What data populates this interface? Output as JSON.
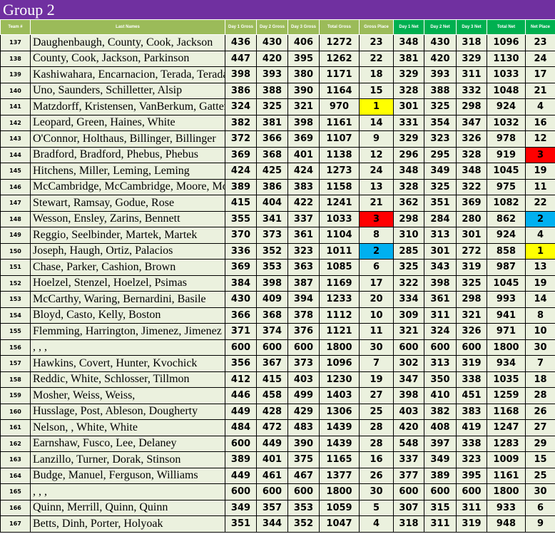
{
  "title": "Group 2",
  "headers": {
    "team": "Team #",
    "last_names": "Last Names",
    "day1_gross": "Day 1 Gross",
    "day2_gross": "Day 2 Gross",
    "day3_gross": "Day 3 Gross",
    "total_gross": "Total Gross",
    "gross_place": "Gross Place",
    "day1_net": "Day 1 Net",
    "day2_net": "Day 2 Net",
    "day3_net": "Day 3 Net",
    "total_net": "Total Net",
    "net_place": "Net Place"
  },
  "colors": {
    "title_bg": "#7030a0",
    "header_gross": "#9bbb59",
    "header_net": "#00b050",
    "cell_bg": "#ebf1de",
    "first_place": "#ffff00",
    "second_place": "#00b0f0",
    "third_place": "#ff0000"
  },
  "rows": [
    {
      "team": "137",
      "names": "Daughenbaugh, County, Cook, Jackson",
      "g1": "436",
      "g2": "430",
      "g3": "406",
      "gt": "1272",
      "gp": "23",
      "n1": "348",
      "n2": "430",
      "n3": "318",
      "nt": "1096",
      "np": "23",
      "gp_hl": "",
      "np_hl": ""
    },
    {
      "team": "138",
      "names": "County, Cook, Jackson, Parkinson",
      "g1": "447",
      "g2": "420",
      "g3": "395",
      "gt": "1262",
      "gp": "22",
      "n1": "381",
      "n2": "420",
      "n3": "329",
      "nt": "1130",
      "np": "24",
      "gp_hl": "",
      "np_hl": ""
    },
    {
      "team": "139",
      "names": "Kashiwahara, Encarnacion, Terada, Terada",
      "g1": "398",
      "g2": "393",
      "g3": "380",
      "gt": "1171",
      "gp": "18",
      "n1": "329",
      "n2": "393",
      "n3": "311",
      "nt": "1033",
      "np": "17",
      "gp_hl": "",
      "np_hl": ""
    },
    {
      "team": "140",
      "names": "Uno, Saunders, Schilletter, Alsip",
      "g1": "386",
      "g2": "388",
      "g3": "390",
      "gt": "1164",
      "gp": "15",
      "n1": "328",
      "n2": "388",
      "n3": "332",
      "nt": "1048",
      "np": "21",
      "gp_hl": "",
      "np_hl": ""
    },
    {
      "team": "141",
      "names": "Matzdorff, Kristensen, VanBerkum, Gatten",
      "g1": "324",
      "g2": "325",
      "g3": "321",
      "gt": "970",
      "gp": "1",
      "n1": "301",
      "n2": "325",
      "n3": "298",
      "nt": "924",
      "np": "4",
      "gp_hl": "yellow",
      "np_hl": ""
    },
    {
      "team": "142",
      "names": "Leopard, Green, Haines, White",
      "g1": "382",
      "g2": "381",
      "g3": "398",
      "gt": "1161",
      "gp": "14",
      "n1": "331",
      "n2": "354",
      "n3": "347",
      "nt": "1032",
      "np": "16",
      "gp_hl": "",
      "np_hl": ""
    },
    {
      "team": "143",
      "names": "O'Connor, Holthaus, Billinger, Billinger",
      "g1": "372",
      "g2": "366",
      "g3": "369",
      "gt": "1107",
      "gp": "9",
      "n1": "329",
      "n2": "323",
      "n3": "326",
      "nt": "978",
      "np": "12",
      "gp_hl": "",
      "np_hl": ""
    },
    {
      "team": "144",
      "names": "Bradford, Bradford, Phebus, Phebus",
      "g1": "369",
      "g2": "368",
      "g3": "401",
      "gt": "1138",
      "gp": "12",
      "n1": "296",
      "n2": "295",
      "n3": "328",
      "nt": "919",
      "np": "3",
      "gp_hl": "",
      "np_hl": "red"
    },
    {
      "team": "145",
      "names": "Hitchens, Miller, Leming, Leming",
      "g1": "424",
      "g2": "425",
      "g3": "424",
      "gt": "1273",
      "gp": "24",
      "n1": "348",
      "n2": "349",
      "n3": "348",
      "nt": "1045",
      "np": "19",
      "gp_hl": "",
      "np_hl": ""
    },
    {
      "team": "146",
      "names": "McCambridge, McCambridge, Moore, Moore",
      "g1": "389",
      "g2": "386",
      "g3": "383",
      "gt": "1158",
      "gp": "13",
      "n1": "328",
      "n2": "325",
      "n3": "322",
      "nt": "975",
      "np": "11",
      "gp_hl": "",
      "np_hl": ""
    },
    {
      "team": "147",
      "names": "Stewart, Ramsay, Godue, Rose",
      "g1": "415",
      "g2": "404",
      "g3": "422",
      "gt": "1241",
      "gp": "21",
      "n1": "362",
      "n2": "351",
      "n3": "369",
      "nt": "1082",
      "np": "22",
      "gp_hl": "",
      "np_hl": ""
    },
    {
      "team": "148",
      "names": "Wesson, Ensley, Zarins, Bennett",
      "g1": "355",
      "g2": "341",
      "g3": "337",
      "gt": "1033",
      "gp": "3",
      "n1": "298",
      "n2": "284",
      "n3": "280",
      "nt": "862",
      "np": "2",
      "gp_hl": "red",
      "np_hl": "blue"
    },
    {
      "team": "149",
      "names": "Reggio, Seelbinder, Martek, Martek",
      "g1": "370",
      "g2": "373",
      "g3": "361",
      "gt": "1104",
      "gp": "8",
      "n1": "310",
      "n2": "313",
      "n3": "301",
      "nt": "924",
      "np": "4",
      "gp_hl": "",
      "np_hl": ""
    },
    {
      "team": "150",
      "names": "Joseph, Haugh, Ortiz, Palacios",
      "g1": "336",
      "g2": "352",
      "g3": "323",
      "gt": "1011",
      "gp": "2",
      "n1": "285",
      "n2": "301",
      "n3": "272",
      "nt": "858",
      "np": "1",
      "gp_hl": "blue",
      "np_hl": "yellow"
    },
    {
      "team": "151",
      "names": "Chase, Parker, Cashion, Brown",
      "g1": "369",
      "g2": "353",
      "g3": "363",
      "gt": "1085",
      "gp": "6",
      "n1": "325",
      "n2": "343",
      "n3": "319",
      "nt": "987",
      "np": "13",
      "gp_hl": "",
      "np_hl": ""
    },
    {
      "team": "152",
      "names": "Hoelzel, Stenzel, Hoelzel, Psimas",
      "g1": "384",
      "g2": "398",
      "g3": "387",
      "gt": "1169",
      "gp": "17",
      "n1": "322",
      "n2": "398",
      "n3": "325",
      "nt": "1045",
      "np": "19",
      "gp_hl": "",
      "np_hl": ""
    },
    {
      "team": "153",
      "names": "McCarthy, Waring, Bernardini, Basile",
      "g1": "430",
      "g2": "409",
      "g3": "394",
      "gt": "1233",
      "gp": "20",
      "n1": "334",
      "n2": "361",
      "n3": "298",
      "nt": "993",
      "np": "14",
      "gp_hl": "",
      "np_hl": ""
    },
    {
      "team": "154",
      "names": "Bloyd, Casto, Kelly, Boston",
      "g1": "366",
      "g2": "368",
      "g3": "378",
      "gt": "1112",
      "gp": "10",
      "n1": "309",
      "n2": "311",
      "n3": "321",
      "nt": "941",
      "np": "8",
      "gp_hl": "",
      "np_hl": ""
    },
    {
      "team": "155",
      "names": "Flemming, Harrington, Jimenez, Jimenez",
      "g1": "371",
      "g2": "374",
      "g3": "376",
      "gt": "1121",
      "gp": "11",
      "n1": "321",
      "n2": "324",
      "n3": "326",
      "nt": "971",
      "np": "10",
      "gp_hl": "",
      "np_hl": ""
    },
    {
      "team": "156",
      "names": ", , ,",
      "g1": "600",
      "g2": "600",
      "g3": "600",
      "gt": "1800",
      "gp": "30",
      "n1": "600",
      "n2": "600",
      "n3": "600",
      "nt": "1800",
      "np": "30",
      "gp_hl": "",
      "np_hl": ""
    },
    {
      "team": "157",
      "names": "Hawkins, Covert, Hunter, Kvochick",
      "g1": "356",
      "g2": "367",
      "g3": "373",
      "gt": "1096",
      "gp": "7",
      "n1": "302",
      "n2": "313",
      "n3": "319",
      "nt": "934",
      "np": "7",
      "gp_hl": "",
      "np_hl": ""
    },
    {
      "team": "158",
      "names": "Reddic, White, Schlosser, Tillmon",
      "g1": "412",
      "g2": "415",
      "g3": "403",
      "gt": "1230",
      "gp": "19",
      "n1": "347",
      "n2": "350",
      "n3": "338",
      "nt": "1035",
      "np": "18",
      "gp_hl": "",
      "np_hl": ""
    },
    {
      "team": "159",
      "names": "Mosher, Weiss, Weiss,",
      "g1": "446",
      "g2": "458",
      "g3": "499",
      "gt": "1403",
      "gp": "27",
      "n1": "398",
      "n2": "410",
      "n3": "451",
      "nt": "1259",
      "np": "28",
      "gp_hl": "",
      "np_hl": ""
    },
    {
      "team": "160",
      "names": "Husslage, Post, Ableson, Dougherty",
      "g1": "449",
      "g2": "428",
      "g3": "429",
      "gt": "1306",
      "gp": "25",
      "n1": "403",
      "n2": "382",
      "n3": "383",
      "nt": "1168",
      "np": "26",
      "gp_hl": "",
      "np_hl": ""
    },
    {
      "team": "161",
      "names": "Nelson, , White, White",
      "g1": "484",
      "g2": "472",
      "g3": "483",
      "gt": "1439",
      "gp": "28",
      "n1": "420",
      "n2": "408",
      "n3": "419",
      "nt": "1247",
      "np": "27",
      "gp_hl": "",
      "np_hl": ""
    },
    {
      "team": "162",
      "names": "Earnshaw, Fusco, Lee, Delaney",
      "g1": "600",
      "g2": "449",
      "g3": "390",
      "gt": "1439",
      "gp": "28",
      "n1": "548",
      "n2": "397",
      "n3": "338",
      "nt": "1283",
      "np": "29",
      "gp_hl": "",
      "np_hl": ""
    },
    {
      "team": "163",
      "names": "Lanzillo, Turner, Dorak, Stinson",
      "g1": "389",
      "g2": "401",
      "g3": "375",
      "gt": "1165",
      "gp": "16",
      "n1": "337",
      "n2": "349",
      "n3": "323",
      "nt": "1009",
      "np": "15",
      "gp_hl": "",
      "np_hl": ""
    },
    {
      "team": "164",
      "names": "Budge, Manuel, Ferguson, Williams",
      "g1": "449",
      "g2": "461",
      "g3": "467",
      "gt": "1377",
      "gp": "26",
      "n1": "377",
      "n2": "389",
      "n3": "395",
      "nt": "1161",
      "np": "25",
      "gp_hl": "",
      "np_hl": ""
    },
    {
      "team": "165",
      "names": ", , ,",
      "g1": "600",
      "g2": "600",
      "g3": "600",
      "gt": "1800",
      "gp": "30",
      "n1": "600",
      "n2": "600",
      "n3": "600",
      "nt": "1800",
      "np": "30",
      "gp_hl": "",
      "np_hl": ""
    },
    {
      "team": "166",
      "names": "Quinn, Merrill, Quinn, Quinn",
      "g1": "349",
      "g2": "357",
      "g3": "353",
      "gt": "1059",
      "gp": "5",
      "n1": "307",
      "n2": "315",
      "n3": "311",
      "nt": "933",
      "np": "6",
      "gp_hl": "",
      "np_hl": ""
    },
    {
      "team": "167",
      "names": "Betts, Dinh, Porter, Holyoak",
      "g1": "351",
      "g2": "344",
      "g3": "352",
      "gt": "1047",
      "gp": "4",
      "n1": "318",
      "n2": "311",
      "n3": "319",
      "nt": "948",
      "np": "9",
      "gp_hl": "",
      "np_hl": ""
    }
  ]
}
